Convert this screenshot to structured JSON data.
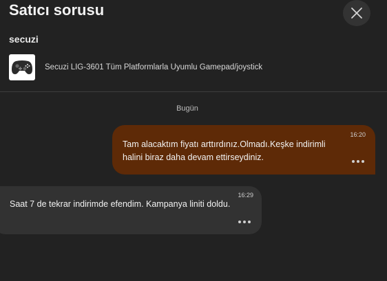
{
  "header": {
    "title": "Satıcı sorusu",
    "close_icon": "close-icon"
  },
  "seller": {
    "name": "secuzi"
  },
  "product": {
    "name": "Secuzi LIG-3601 Tüm Platformlarla Uyumlu Gamepad/joystick",
    "thumbnail_icon": "gamepad-icon"
  },
  "conversation": {
    "date_label": "Bugün",
    "messages": [
      {
        "direction": "outgoing",
        "text": "Tam alacaktım fiyatı arttırdınız.Olmadı.Keşke indirimli halini biraz daha devam ettirseydiniz.",
        "time": "16:20",
        "bubble_color": "#5e2a07",
        "more_icon": "more-dots-icon"
      },
      {
        "direction": "incoming",
        "text": "Saat 7 de tekrar indirimde efendim. Kampanya liniti doldu.",
        "time": "16:29",
        "bubble_color": "#323232",
        "more_icon": "more-dots-icon"
      }
    ]
  },
  "colors": {
    "background": "#222222",
    "outgoing_bubble": "#5e2a07",
    "incoming_bubble": "#323232"
  }
}
